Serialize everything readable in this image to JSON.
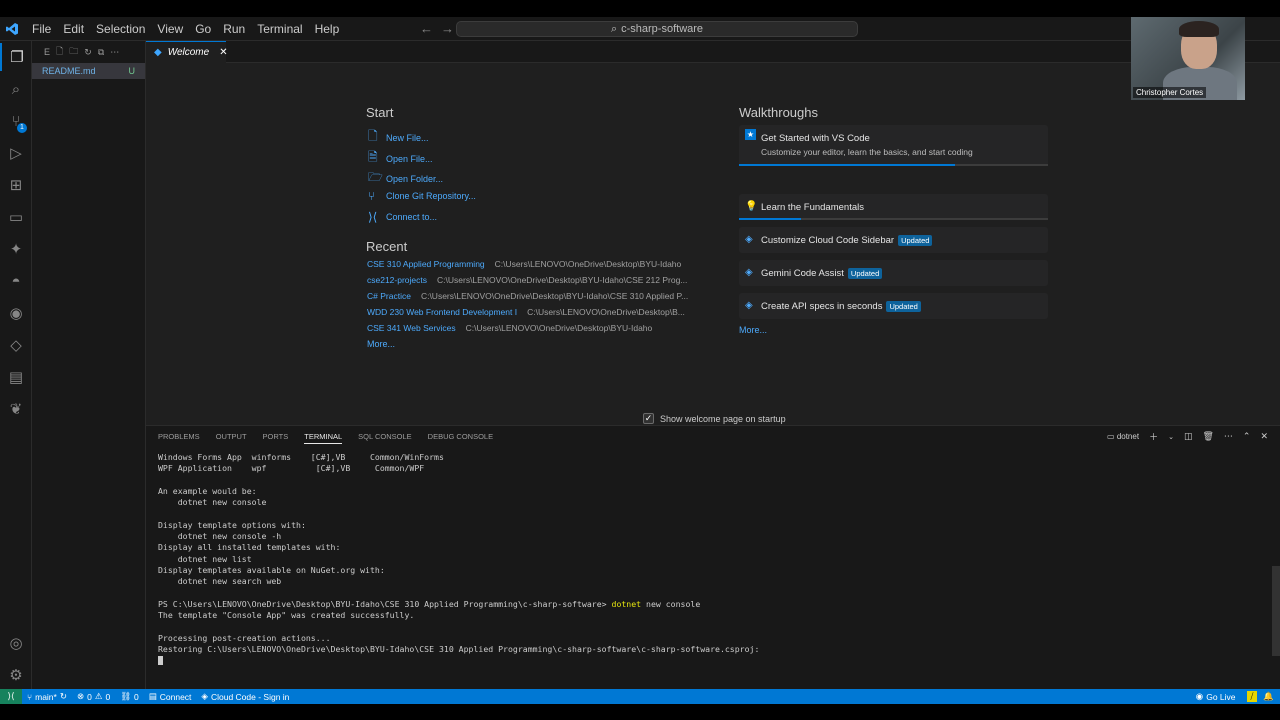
{
  "titlebar": {
    "menu": [
      "File",
      "Edit",
      "Selection",
      "View",
      "Go",
      "Run",
      "Terminal",
      "Help"
    ],
    "command_center": "c-sharp-software"
  },
  "sidebar": {
    "section_letter": "E",
    "files": [
      {
        "name": "README.md",
        "status": "U"
      }
    ]
  },
  "tabs": [
    {
      "label": "Welcome"
    }
  ],
  "welcome": {
    "start_title": "Start",
    "start_items": [
      "New File...",
      "Open File...",
      "Open Folder...",
      "Clone Git Repository...",
      "Connect to..."
    ],
    "recent_title": "Recent",
    "recent": [
      {
        "name": "CSE 310 Applied Programming",
        "path": "C:\\Users\\LENOVO\\OneDrive\\Desktop\\BYU-Idaho"
      },
      {
        "name": "cse212-projects",
        "path": "C:\\Users\\LENOVO\\OneDrive\\Desktop\\BYU-Idaho\\CSE 212 Prog..."
      },
      {
        "name": "C# Practice",
        "path": "C:\\Users\\LENOVO\\OneDrive\\Desktop\\BYU-Idaho\\CSE 310 Applied P..."
      },
      {
        "name": "WDD 230 Web Frontend Development I",
        "path": "C:\\Users\\LENOVO\\OneDrive\\Desktop\\B..."
      },
      {
        "name": "CSE 341 Web Services",
        "path": "C:\\Users\\LENOVO\\OneDrive\\Desktop\\BYU-Idaho"
      }
    ],
    "recent_more": "More...",
    "walkthroughs_title": "Walkthroughs",
    "walkthroughs": [
      {
        "title": "Get Started with VS Code",
        "desc": "Customize your editor, learn the basics, and start coding",
        "progress": 0.7
      },
      {
        "title": "Learn the Fundamentals",
        "progress": 0.2
      },
      {
        "title": "Customize Cloud Code Sidebar",
        "badge": "Updated"
      },
      {
        "title": "Gemini Code Assist",
        "badge": "Updated"
      },
      {
        "title": "Create API specs in seconds",
        "badge": "Updated"
      }
    ],
    "walkthroughs_more": "More...",
    "show_on_startup": "Show welcome page on startup"
  },
  "panel": {
    "tabs": [
      "PROBLEMS",
      "OUTPUT",
      "PORTS",
      "TERMINAL",
      "SQL CONSOLE",
      "DEBUG CONSOLE"
    ],
    "active_tab": "TERMINAL",
    "terminal_name": "dotnet",
    "terminal": {
      "line1": "Windows Forms App  winforms    [C#],VB     Common/WinForms",
      "line2": "WPF Application    wpf          [C#],VB     Common/WPF",
      "line3": "An example would be:",
      "line4": "    dotnet new console",
      "line5": "Display template options with:",
      "line6": "    dotnet new console -h",
      "line7": "Display all installed templates with:",
      "line8": "    dotnet new list",
      "line9": "Display templates available on NuGet.org with:",
      "line10": "    dotnet new search web",
      "prompt": "PS C:\\Users\\LENOVO\\OneDrive\\Desktop\\BYU-Idaho\\CSE 310 Applied Programming\\c-sharp-software>",
      "command": "dotnet",
      "command_rest": " new console",
      "line11": "The template \"Console App\" was created successfully.",
      "line12": "Processing post-creation actions...",
      "line13": "Restoring C:\\Users\\LENOVO\\OneDrive\\Desktop\\BYU-Idaho\\CSE 310 Applied Programming\\c-sharp-software\\c-sharp-software.csproj:"
    }
  },
  "statusbar": {
    "branch": "main*",
    "errors": "0",
    "warnings": "0",
    "ports": "0",
    "connect": "Connect",
    "cloud_code": "Cloud Code - Sign in",
    "go_live": "Go Live"
  },
  "webcam": {
    "name": "Christopher Cortes"
  },
  "colors": {
    "accent": "#0078d4",
    "link": "#4daafc",
    "remote": "#16825d"
  }
}
